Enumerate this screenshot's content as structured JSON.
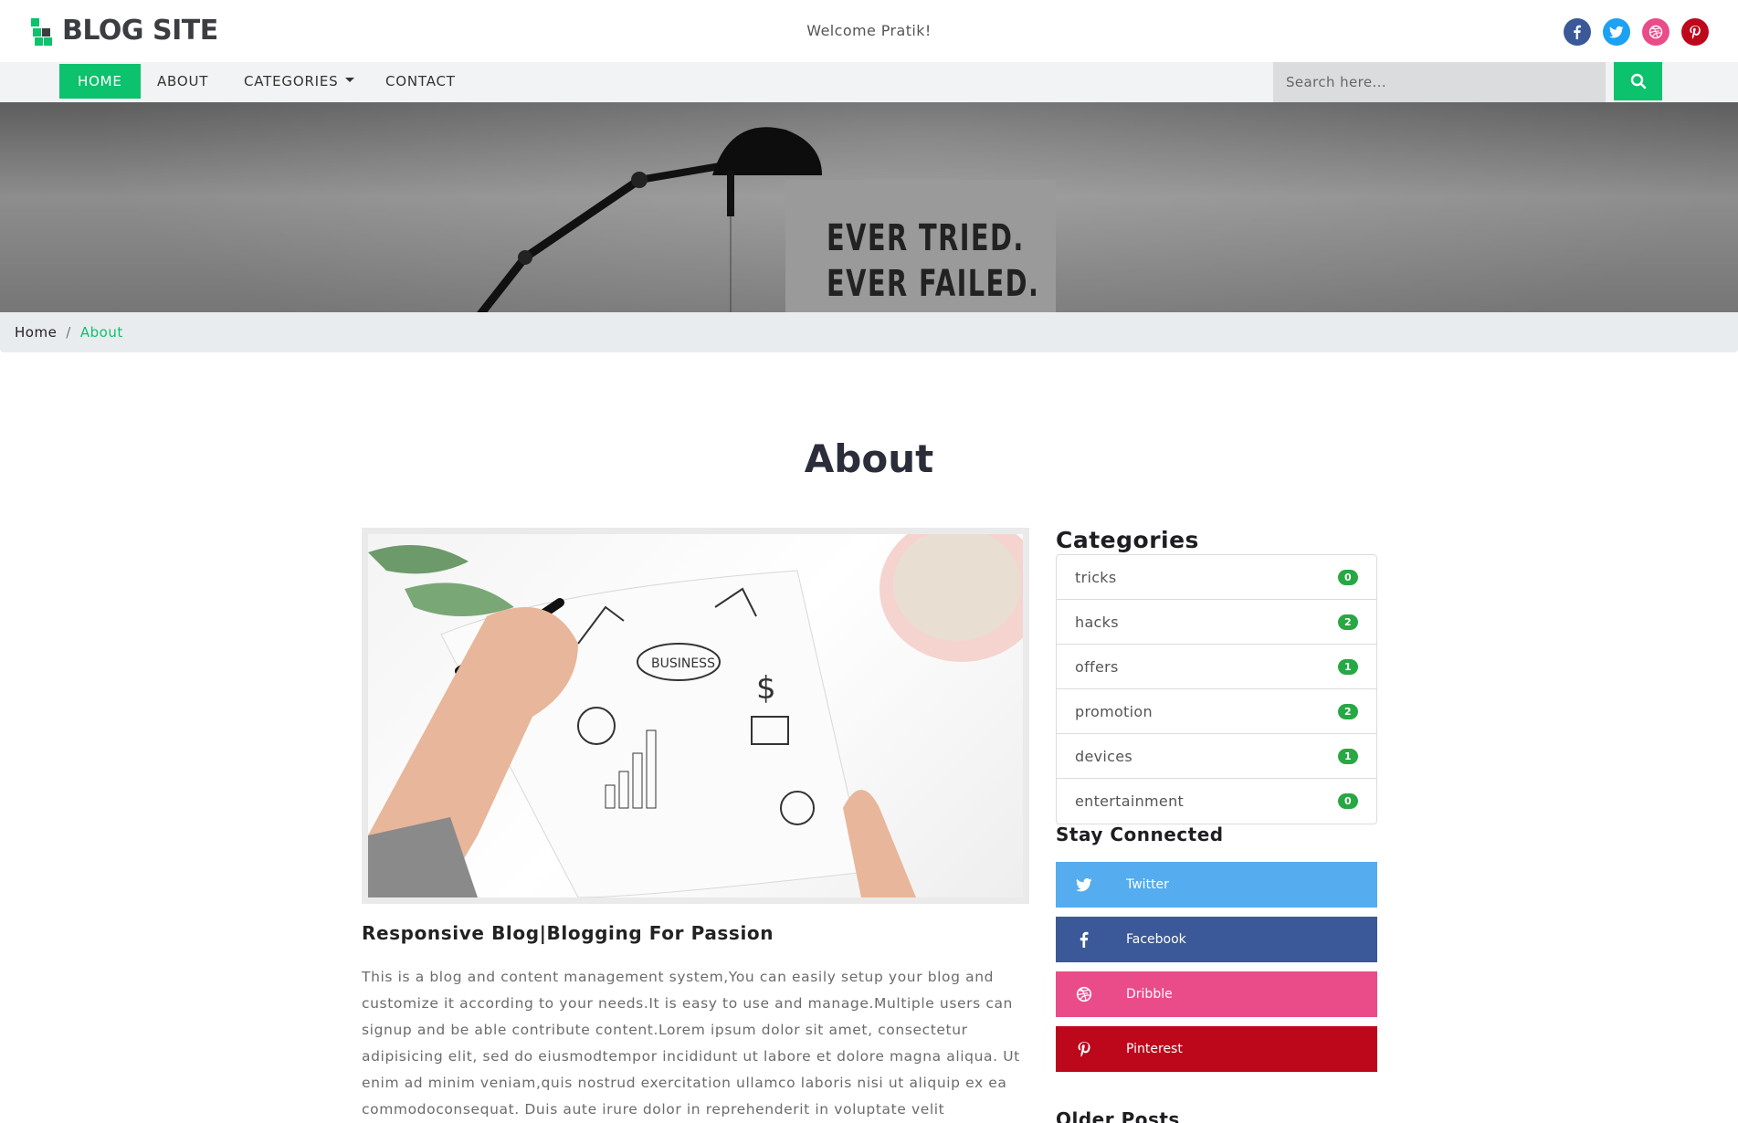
{
  "brand": {
    "name": "BLOG SITE",
    "accent": "#0cc26c"
  },
  "header": {
    "welcome": "Welcome Pratik!"
  },
  "social_top": [
    {
      "icon": "facebook-icon",
      "color": "#3b5998"
    },
    {
      "icon": "twitter-icon",
      "color": "#1da1f2"
    },
    {
      "icon": "dribbble-icon",
      "color": "#ea4c89"
    },
    {
      "icon": "pinterest-icon",
      "color": "#bd081c"
    }
  ],
  "nav": {
    "home": "HOME",
    "about": "ABOUT",
    "categories": "CATEGORIES",
    "contact": "CONTACT",
    "search_placeholder": "Search here..."
  },
  "hero": {
    "quote_line1": "EVER TRIED.",
    "quote_line2": "EVER FAILED."
  },
  "breadcrumb": {
    "home": "Home",
    "current": "About"
  },
  "main": {
    "title": "About",
    "post_title": "Responsive Blog|Blogging For Passion",
    "post_body": "This is a blog and content management system,You can easily setup your blog and customize it according to your needs.It is easy to use and manage.Multiple users can signup and be able contribute content.Lorem ipsum dolor sit amet, consectetur adipisicing elit, sed do eiusmodtempor incididunt ut labore et dolore magna aliqua. Ut enim ad minim veniam,quis nostrud exercitation ullamco laboris nisi ut aliquip ex ea commodoconsequat. Duis aute irure dolor in reprehenderit in voluptate velit essecillum"
  },
  "sidebar": {
    "categories_title": "Categories",
    "categories": [
      {
        "name": "tricks",
        "count": "0"
      },
      {
        "name": "hacks",
        "count": "2"
      },
      {
        "name": "offers",
        "count": "1"
      },
      {
        "name": "promotion",
        "count": "2"
      },
      {
        "name": "devices",
        "count": "1"
      },
      {
        "name": "entertainment",
        "count": "0"
      }
    ],
    "stay_title": "Stay Connected",
    "social": [
      {
        "label": "Twitter",
        "icon": "twitter-icon",
        "color": "#55acee"
      },
      {
        "label": "Facebook",
        "icon": "facebook-icon",
        "color": "#3b5998"
      },
      {
        "label": "Dribble",
        "icon": "dribbble-icon",
        "color": "#ea4c89"
      },
      {
        "label": "Pinterest",
        "icon": "pinterest-icon",
        "color": "#bd081c"
      }
    ],
    "older_title": "Older Posts"
  }
}
